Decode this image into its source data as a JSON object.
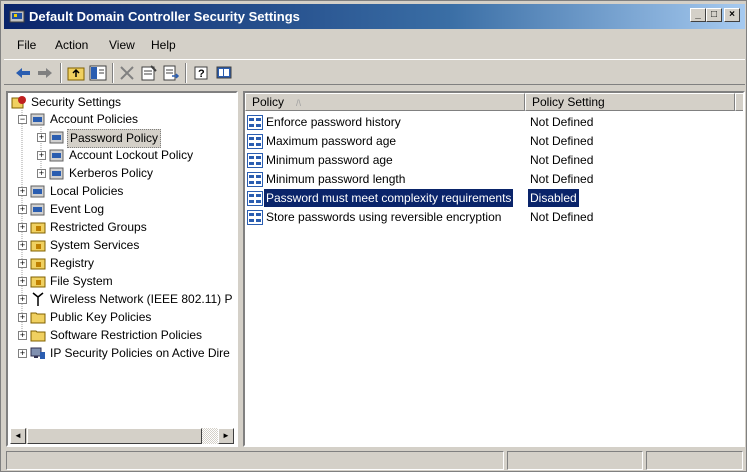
{
  "window": {
    "title": "Default Domain Controller Security Settings",
    "controls": {
      "minimize": "_",
      "maximize": "□",
      "close": "×"
    }
  },
  "menu": {
    "items": [
      {
        "label": "File",
        "icon": ""
      },
      {
        "label": "Action",
        "icon": ""
      },
      {
        "label": "View",
        "icon": ""
      },
      {
        "label": "Help",
        "icon": ""
      }
    ]
  },
  "toolbar": {
    "buttons": [
      "back-arrow-icon",
      "forward-arrow-icon",
      "up-folder-icon",
      "show-hide-tree-icon",
      "delete-icon",
      "properties-icon",
      "export-list-icon",
      "help-icon",
      "console-icon"
    ]
  },
  "tree": {
    "items": [
      {
        "label": "Security Settings",
        "icon": "security-settings-icon",
        "expander": ""
      },
      {
        "label": "Account Policies",
        "icon": "policy-folder-icon",
        "expander": "−"
      },
      {
        "label": "Password Policy",
        "icon": "policy-folder-icon",
        "expander": "+"
      },
      {
        "label": "Account Lockout Policy",
        "icon": "policy-folder-icon",
        "expander": "+"
      },
      {
        "label": "Kerberos Policy",
        "icon": "policy-folder-icon",
        "expander": "+"
      },
      {
        "label": "Local Policies",
        "icon": "policy-folder-icon",
        "expander": "+"
      },
      {
        "label": "Event Log",
        "icon": "policy-folder-icon",
        "expander": "+"
      },
      {
        "label": "Restricted Groups",
        "icon": "locked-folder-icon",
        "expander": "+"
      },
      {
        "label": "System Services",
        "icon": "locked-folder-icon",
        "expander": "+"
      },
      {
        "label": "Registry",
        "icon": "locked-folder-icon",
        "expander": "+"
      },
      {
        "label": "File System",
        "icon": "locked-folder-icon",
        "expander": "+"
      },
      {
        "label": "Wireless Network (IEEE 802.11) P",
        "icon": "antenna-icon",
        "expander": "+"
      },
      {
        "label": "Public Key Policies",
        "icon": "folder-icon",
        "expander": "+"
      },
      {
        "label": "Software Restriction Policies",
        "icon": "folder-icon",
        "expander": "+"
      },
      {
        "label": "IP Security Policies on Active Dire",
        "icon": "ip-security-icon",
        "expander": "+"
      }
    ]
  },
  "list": {
    "columns": [
      "Policy",
      "Policy Setting"
    ],
    "sort_indicator": "/\\",
    "rows": [
      {
        "policy": "Enforce password history",
        "setting": "Not Defined"
      },
      {
        "policy": "Maximum password age",
        "setting": "Not Defined"
      },
      {
        "policy": "Minimum password age",
        "setting": "Not Defined"
      },
      {
        "policy": "Minimum password length",
        "setting": "Not Defined"
      },
      {
        "policy": "Password must meet complexity requirements",
        "setting": "Disabled"
      },
      {
        "policy": "Store passwords using reversible encryption",
        "setting": "Not Defined"
      }
    ]
  },
  "scrollbar": {
    "left_arrow": "◄",
    "right_arrow": "►"
  },
  "colors": {
    "titlebar_start": "#0a246a",
    "selection": "#0a246a",
    "face": "#d4d0c8"
  }
}
